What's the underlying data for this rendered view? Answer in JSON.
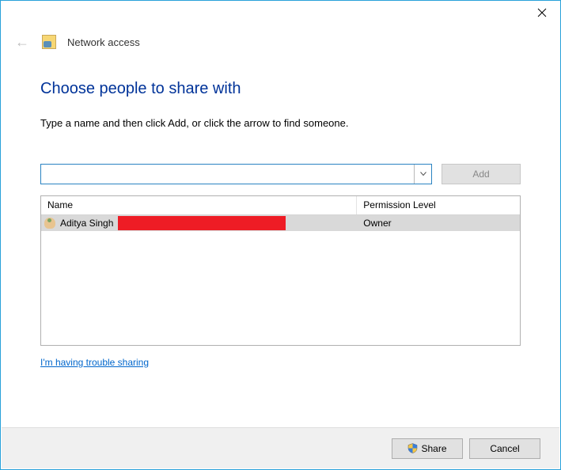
{
  "window": {
    "close_tooltip": "Close"
  },
  "header": {
    "title": "Network access"
  },
  "main": {
    "heading": "Choose people to share with",
    "instruction": "Type a name and then click Add, or click the arrow to find someone.",
    "search_value": "",
    "add_label": "Add",
    "columns": {
      "name": "Name",
      "permission": "Permission Level"
    },
    "rows": [
      {
        "name": "Aditya Singh",
        "permission": "Owner",
        "redacted": true
      }
    ],
    "trouble_link": "I'm having trouble sharing"
  },
  "footer": {
    "share_label": "Share",
    "cancel_label": "Cancel"
  }
}
